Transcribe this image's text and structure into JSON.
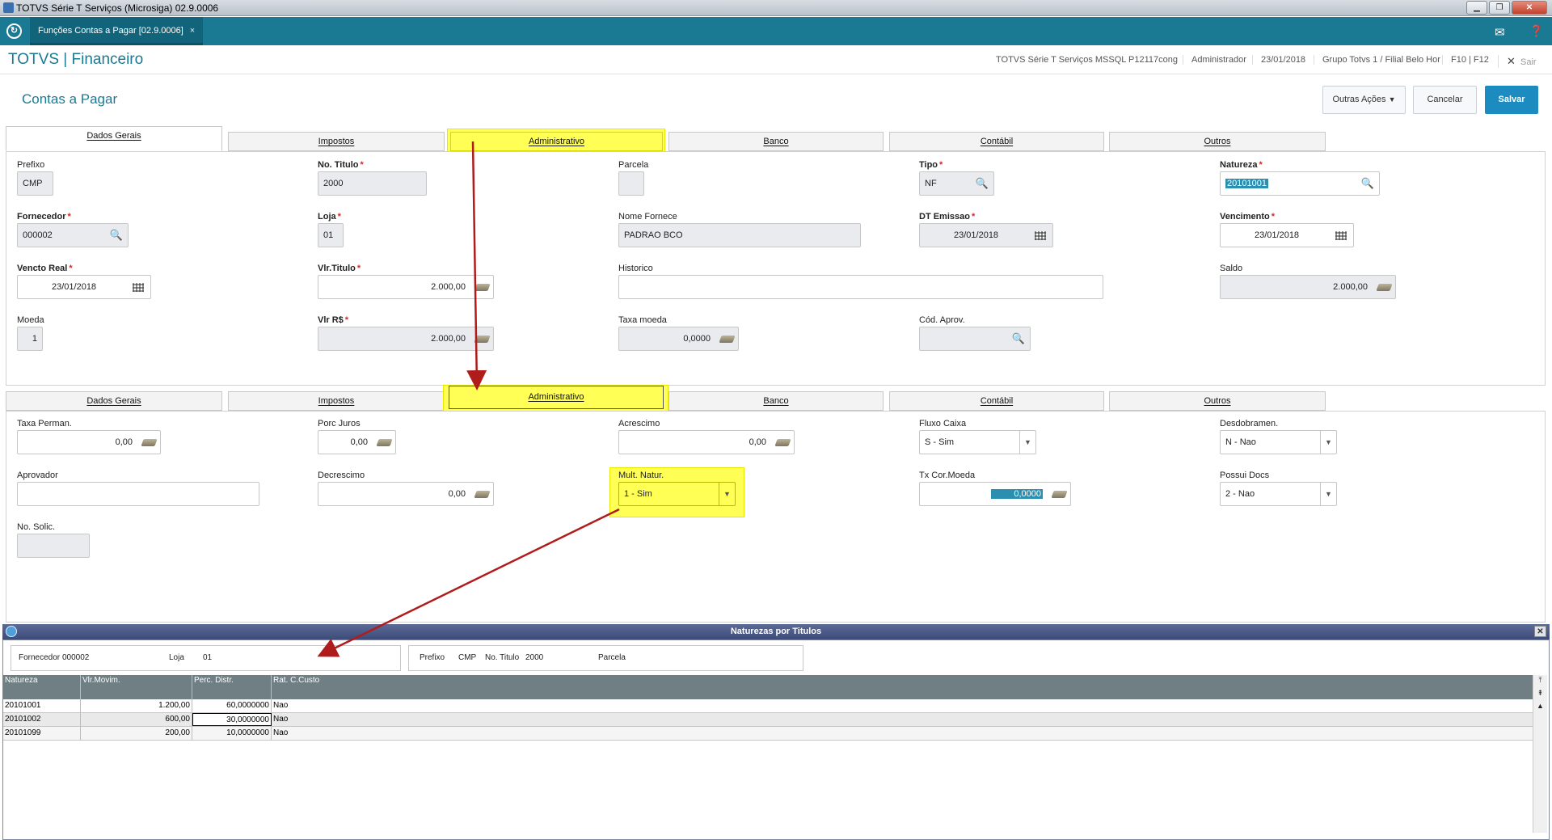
{
  "window": {
    "title": "TOTVS Série T Serviços (Microsiga) 02.9.0006"
  },
  "topbar": {
    "tab_label": "Funções Contas a Pagar [02.9.0006]",
    "tab_close": "×"
  },
  "header": {
    "brand": "TOTVS | Financeiro",
    "environment": "TOTVS Série T Serviços MSSQL P12117cong",
    "user": "Administrador",
    "date": "23/01/2018",
    "branch": "Grupo Totvs 1 / Filial Belo Hor",
    "keys": "F10 | F12",
    "exit": "Sair"
  },
  "page": {
    "title": "Contas a Pagar",
    "actions": {
      "other": "Outras Ações",
      "cancel": "Cancelar",
      "save": "Salvar"
    }
  },
  "tabs": [
    "Dados Gerais",
    "Impostos",
    "Administrativo",
    "Banco",
    "Contábil",
    "Outros"
  ],
  "general": {
    "prefixo": {
      "label": "Prefixo",
      "value": "CMP"
    },
    "no_titulo": {
      "label": "No. Titulo",
      "value": "2000"
    },
    "parcela": {
      "label": "Parcela",
      "value": ""
    },
    "tipo": {
      "label": "Tipo",
      "value": "NF"
    },
    "natureza": {
      "label": "Natureza",
      "value": "20101001"
    },
    "fornecedor": {
      "label": "Fornecedor",
      "value": "000002"
    },
    "loja": {
      "label": "Loja",
      "value": "01"
    },
    "nome_fornece": {
      "label": "Nome Fornece",
      "value": "PADRAO BCO"
    },
    "dt_emissao": {
      "label": "DT Emissao",
      "value": "23/01/2018"
    },
    "vencimento": {
      "label": "Vencimento",
      "value": "23/01/2018"
    },
    "vencto_real": {
      "label": "Vencto Real",
      "value": "23/01/2018"
    },
    "vlr_titulo": {
      "label": "Vlr.Titulo",
      "value": "2.000,00"
    },
    "historico": {
      "label": "Historico",
      "value": ""
    },
    "saldo": {
      "label": "Saldo",
      "value": "2.000,00"
    },
    "moeda": {
      "label": "Moeda",
      "value": "1"
    },
    "vlr_rs": {
      "label": "Vlr R$",
      "value": "2.000,00"
    },
    "taxa_moeda": {
      "label": "Taxa moeda",
      "value": "0,0000"
    },
    "cod_aprov": {
      "label": "Cód. Aprov.",
      "value": ""
    }
  },
  "admin": {
    "taxa_perman": {
      "label": "Taxa Perman.",
      "value": "0,00"
    },
    "porc_juros": {
      "label": "Porc Juros",
      "value": "0,00"
    },
    "acrescimo": {
      "label": "Acrescimo",
      "value": "0,00"
    },
    "fluxo_caixa": {
      "label": "Fluxo Caixa",
      "value": "S - Sim"
    },
    "desdobramen": {
      "label": "Desdobramen.",
      "value": "N - Nao"
    },
    "aprovador": {
      "label": "Aprovador",
      "value": ""
    },
    "decrescimo": {
      "label": "Decrescimo",
      "value": "0,00"
    },
    "mult_natur": {
      "label": "Mult. Natur.",
      "value": "1 - Sim"
    },
    "tx_cor_moeda": {
      "label": "Tx Cor.Moeda",
      "value": "0,0000"
    },
    "possui_docs": {
      "label": "Possui Docs",
      "value": "2 - Nao"
    },
    "no_solic": {
      "label": "No. Solic.",
      "value": ""
    }
  },
  "popup": {
    "title": "Naturezas por Titulos",
    "fornecedor_label": "Fornecedor",
    "fornecedor": "000002",
    "loja_label": "Loja",
    "loja": "01",
    "prefixo_label": "Prefixo",
    "prefixo": "CMP",
    "titulo_label": "No. Titulo",
    "titulo": "2000",
    "parcela_label": "Parcela",
    "columns": [
      "Natureza",
      "Vlr.Movim.",
      "Perc. Distr.",
      "Rat. C.Custo"
    ],
    "rows": [
      {
        "natureza": "20101001",
        "valor": "1.200,00",
        "perc": "60,0000000",
        "rat": "Nao"
      },
      {
        "natureza": "20101002",
        "valor": "600,00",
        "perc": "30,0000000",
        "rat": "Nao"
      },
      {
        "natureza": "20101099",
        "valor": "200,00",
        "perc": "10,0000000",
        "rat": "Nao"
      }
    ]
  },
  "colors": {
    "brand": "#1a7a93",
    "primary_button": "#1c8bbf",
    "highlight": "#ffff55",
    "arrow": "#b01c1c",
    "popup_title": "#3d4b79"
  }
}
